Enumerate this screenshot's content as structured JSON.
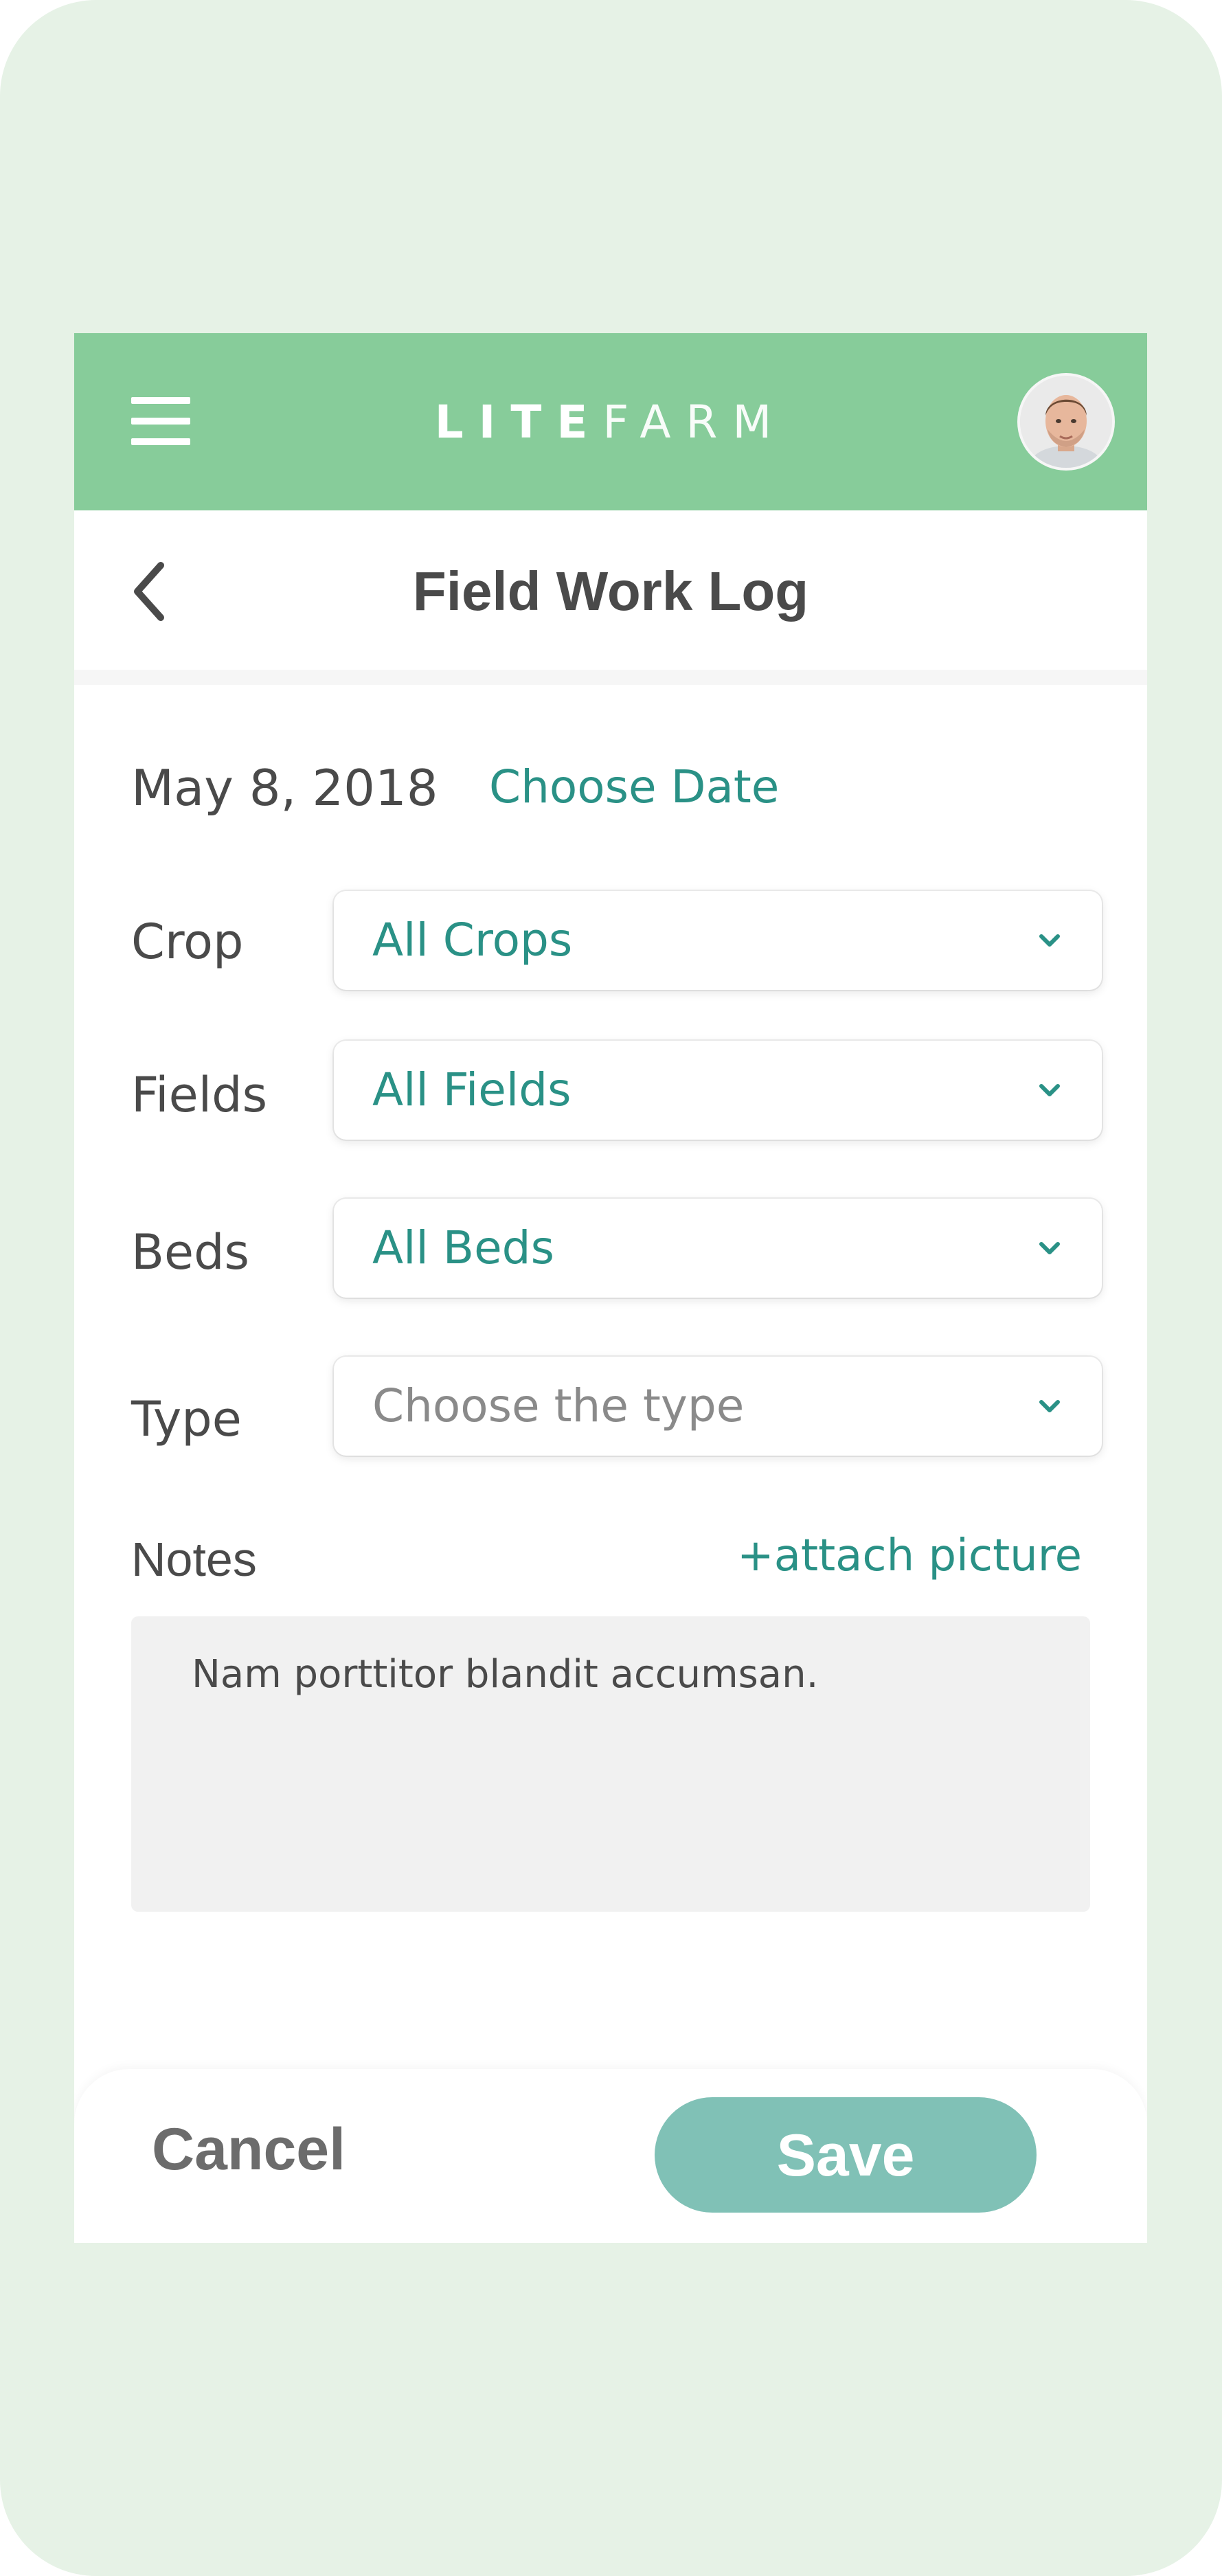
{
  "header": {
    "logo_bold": "LITE",
    "logo_light": "FARM",
    "accent_color": "#87cc9a"
  },
  "titlebar": {
    "title": "Field Work Log",
    "back_icon": "chevron-left-icon"
  },
  "date": {
    "value": "May 8, 2018",
    "choose_label": "Choose Date"
  },
  "fields": [
    {
      "label": "Crop",
      "value": "All Crops",
      "is_placeholder": false
    },
    {
      "label": "Fields",
      "value": "All Fields",
      "is_placeholder": false
    },
    {
      "label": "Beds",
      "value": "All Beds",
      "is_placeholder": false
    },
    {
      "label": "Type",
      "value": "Choose the type",
      "is_placeholder": true
    }
  ],
  "notes": {
    "label": "Notes",
    "attach_label": "+attach picture",
    "value": "Nam porttitor blandit accumsan."
  },
  "footer": {
    "cancel_label": "Cancel",
    "save_label": "Save",
    "save_color": "#80c1b6"
  }
}
